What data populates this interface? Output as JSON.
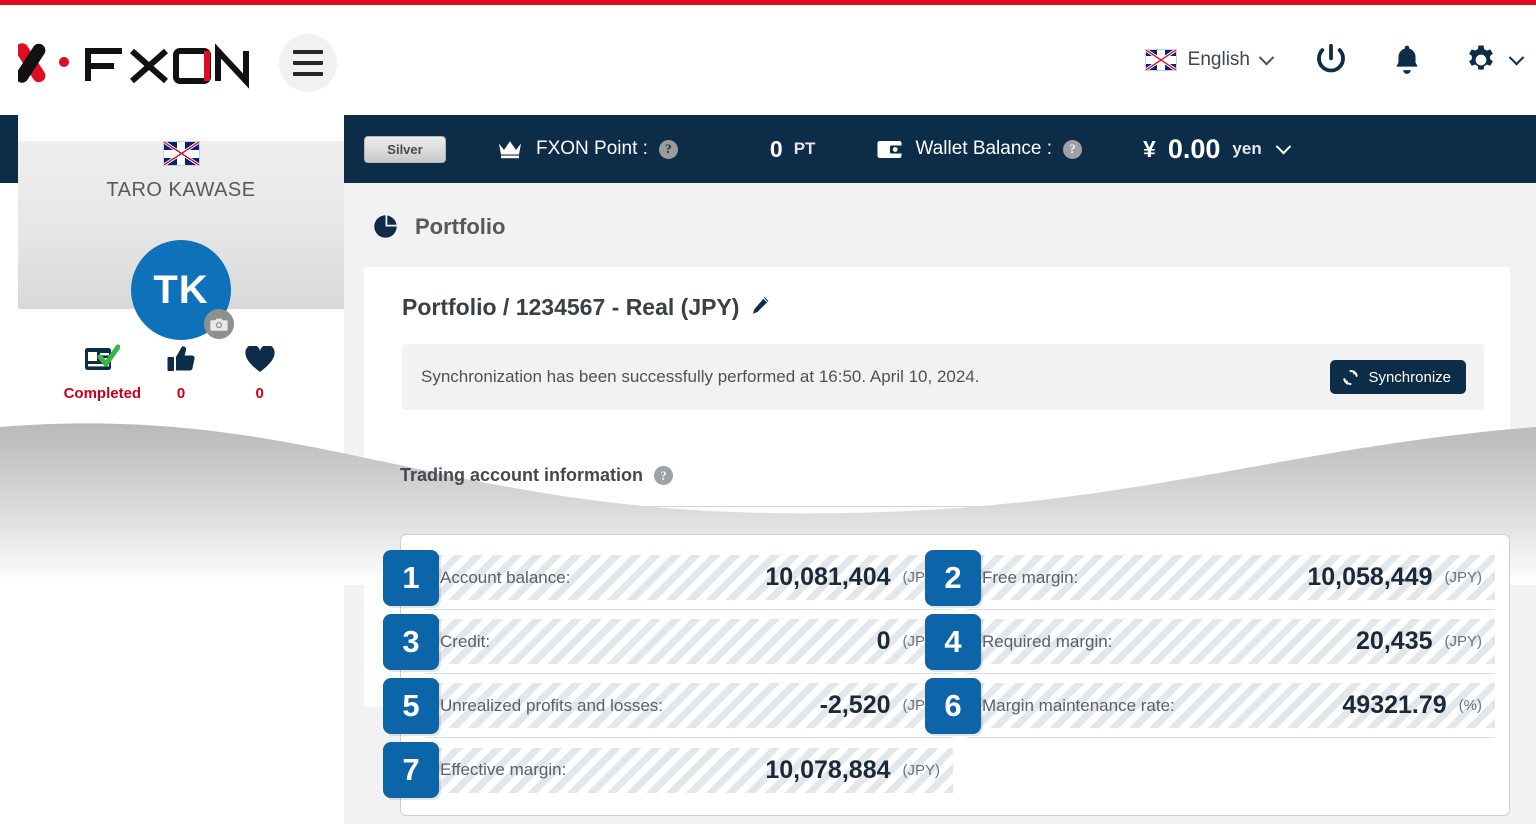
{
  "header": {
    "logo_text": "FXON",
    "menu_icon": "hamburger-icon",
    "language": "English",
    "power_icon": "power-icon",
    "bell_icon": "bell-icon",
    "gear_icon": "gear-icon"
  },
  "sidebar": {
    "country_flag": "uk-flag",
    "user_name": "TARO KAWASE",
    "avatar_initials": "TK",
    "camera_icon": "camera-icon",
    "stats": [
      {
        "icon": "id-card-check-icon",
        "label": "Completed"
      },
      {
        "icon": "thumbs-up-icon",
        "label": "0"
      },
      {
        "icon": "heart-icon",
        "label": "0"
      }
    ]
  },
  "ticker": {
    "rank_chip": "Silver",
    "crown_icon": "crown-icon",
    "point_label": "FXON Point :",
    "point_help": "?",
    "point_value": "0",
    "point_unit": "PT",
    "wallet_icon": "wallet-icon",
    "wallet_label": "Wallet Balance :",
    "wallet_help": "?",
    "currency_symbol": "¥",
    "wallet_value": "0.00",
    "wallet_unit": "yen",
    "wallet_chevron": "chevron-down-icon"
  },
  "page": {
    "icon": "pie-chart-icon",
    "title": "Portfolio"
  },
  "card": {
    "title": "Portfolio / 1234567 - Real (JPY)",
    "edit_icon": "pencil-icon",
    "sync_message": "Synchronization has been successfully performed at 16:50. April 10, 2024.",
    "sync_button": "Synchronize",
    "sync_icon": "refresh-icon"
  },
  "account": {
    "section_title": "Trading account information",
    "section_help": "?",
    "left_rows": [
      {
        "badge": "1",
        "label": "Account balance:",
        "value": "10,081,404",
        "unit": "(JPY)"
      },
      {
        "badge": "3",
        "label": "Credit:",
        "value": "0",
        "unit": "(JPY)"
      },
      {
        "badge": "5",
        "label": "Unrealized profits and losses:",
        "value": "-2,520",
        "unit": "(JPY)"
      },
      {
        "badge": "7",
        "label": "Effective margin:",
        "value": "10,078,884",
        "unit": "(JPY)"
      }
    ],
    "right_rows": [
      {
        "badge": "2",
        "label": "Free margin:",
        "value": "10,058,449",
        "unit": "(JPY)"
      },
      {
        "badge": "4",
        "label": "Required margin:",
        "value": "20,435",
        "unit": "(JPY)"
      },
      {
        "badge": "6",
        "label": "Margin maintenance rate:",
        "value": "49321.79",
        "unit": "(%)"
      }
    ]
  },
  "colors": {
    "accent_red": "#e00b22",
    "navy": "#0c2c47",
    "badge_blue": "#0b65a8",
    "avatar_blue": "#0d72ba",
    "stat_red": "#c90018"
  }
}
